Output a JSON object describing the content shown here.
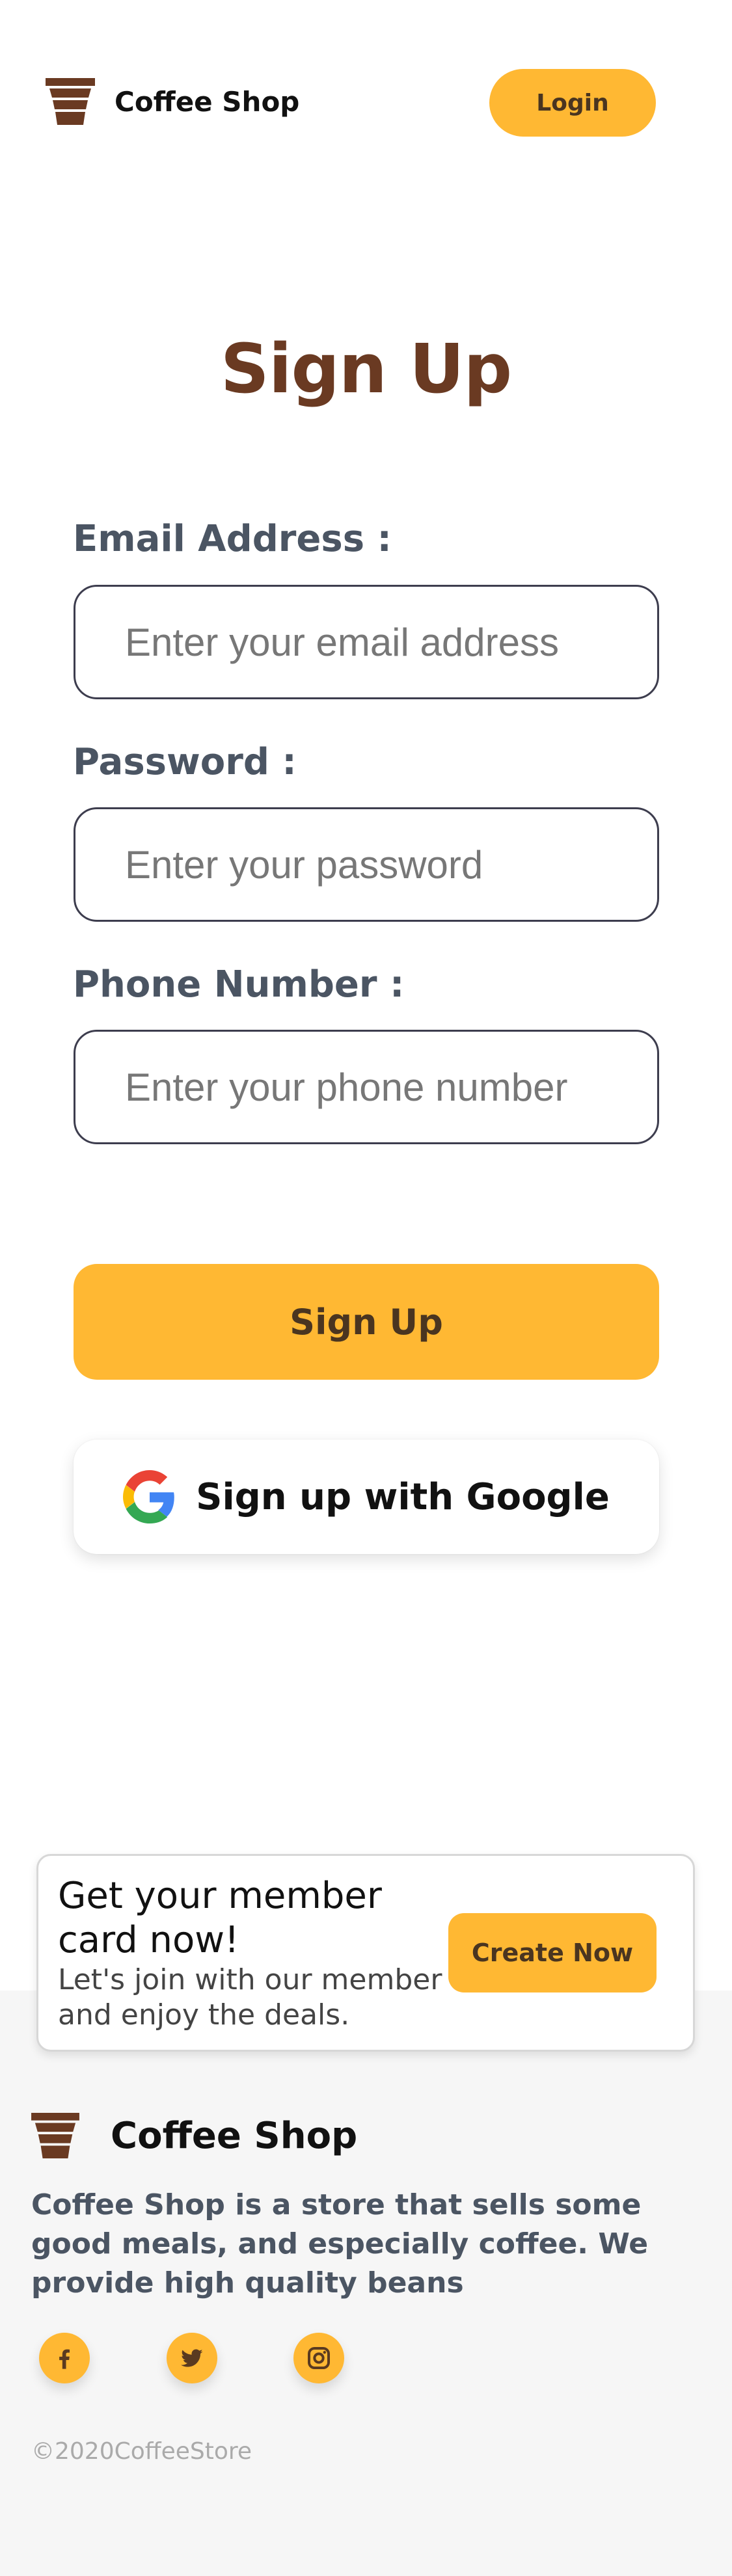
{
  "header": {
    "logo_icon": "coffee-cup-icon",
    "brand": "Coffee Shop",
    "login_label": "Login"
  },
  "form": {
    "title": "Sign Up",
    "email_label": "Email Address :",
    "email_placeholder": "Enter your email address",
    "password_label": "Password :",
    "password_placeholder": "Enter your password",
    "phone_label": "Phone Number :",
    "phone_placeholder": "Enter your phone number",
    "signup_label": "Sign Up",
    "google_icon": "google-icon",
    "google_label": "Sign up with Google"
  },
  "member_card": {
    "title": "Get your member card now!",
    "subtitle": "Let's join with our member and enjoy the deals.",
    "button_label": "Create Now"
  },
  "footer": {
    "brand": "Coffee Shop",
    "description": "Coffee Shop is a store that sells some good meals, and especially coffee. We provide high quality beans",
    "social": [
      {
        "icon": "facebook-icon"
      },
      {
        "icon": "twitter-icon"
      },
      {
        "icon": "instagram-icon"
      }
    ],
    "copyright": "©2020CoffeeStore"
  },
  "colors": {
    "accent": "#FFB833",
    "brand_brown": "#6A3A22",
    "label_gray": "#4B5563"
  }
}
